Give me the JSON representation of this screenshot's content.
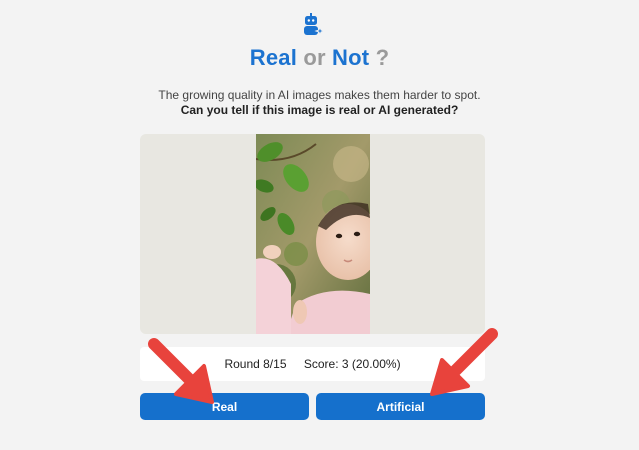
{
  "header": {
    "logo_icon": "robot-sparkle-icon",
    "title_part1": "Real",
    "title_part2": "or",
    "title_part3": "Not",
    "title_part4": "?",
    "subtitle": "The growing quality in AI images makes them harder to spot.",
    "question": "Can you tell if this image is real or AI generated?"
  },
  "game": {
    "round": "Round 8/15",
    "score": "Score: 3 (20.00%)",
    "current_image": "baby-reaching-for-leaves-photo"
  },
  "buttons": {
    "real_label": "Real",
    "artificial_label": "Artificial"
  },
  "colors": {
    "accent": "#1c73d0",
    "button": "#1570cc",
    "annotation_arrow": "#e8433c"
  }
}
